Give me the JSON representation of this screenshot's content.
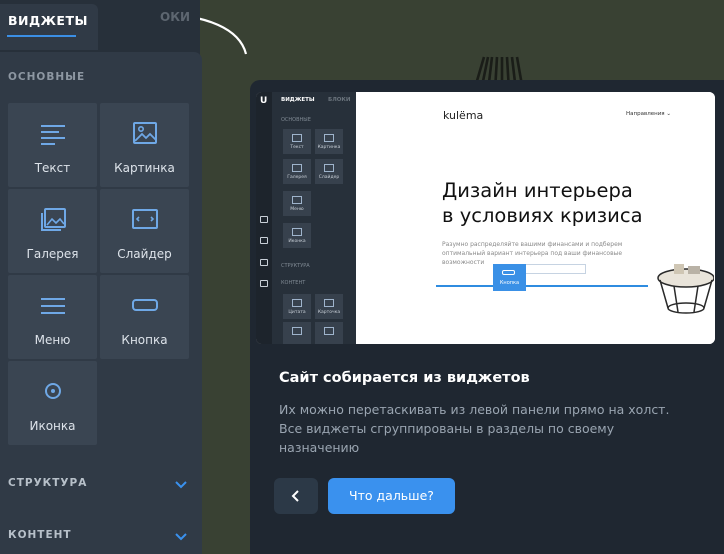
{
  "sidebar": {
    "tab_active": "ВИДЖЕТЫ",
    "tab_inactive": "ОКИ",
    "section_basic": "ОСНОВНЫЕ",
    "widgets": [
      {
        "label": "Текст",
        "icon": "text-icon"
      },
      {
        "label": "Картинка",
        "icon": "image-icon"
      },
      {
        "label": "Галерея",
        "icon": "gallery-icon"
      },
      {
        "label": "Слайдер",
        "icon": "slider-icon"
      },
      {
        "label": "Меню",
        "icon": "menu-icon"
      },
      {
        "label": "Кнопка",
        "icon": "button-icon"
      },
      {
        "label": "Иконка",
        "icon": "icon-widget-icon"
      }
    ],
    "sections": [
      {
        "label": "СТРУКТУРА"
      },
      {
        "label": "КОНТЕНТ"
      }
    ]
  },
  "preview": {
    "app_logo": "U",
    "tab_widgets": "ВИДЖЕТЫ",
    "tab_blocks": "БЛОКИ",
    "section_basic": "ОСНОВНЫЕ",
    "tiles": [
      "Текст",
      "Картинка",
      "Галерея",
      "Слайдер",
      "Меню",
      "Иконка"
    ],
    "section_structure": "СТРУКТУРА",
    "section_content": "КОНТЕНТ",
    "tiles_content": [
      "Цитата",
      "Карточка"
    ],
    "brand": "kulëma",
    "nav_link": "Направления ⌄",
    "heading_line1": "Дизайн интерьера",
    "heading_line2": "в условиях кризиса",
    "paragraph": "Разумно распределяйте вашими финансами и подберем оптимальный вариант интерьера под ваши финансовые возможности",
    "button_label": "Кнопка"
  },
  "tour": {
    "title": "Сайт собирается из виджетов",
    "text_lines": [
      "Их можно перетаскивать из левой панели прямо на холст.",
      "Все виджеты сгруппированы в разделы по своему",
      "назначению"
    ],
    "back_icon": "chevron-left-icon",
    "next_label": "Что дальше?"
  },
  "colors": {
    "accent": "#3a91ee",
    "panel": "#303a46",
    "canvas_bg": "#394133",
    "card": "#1f2731"
  }
}
